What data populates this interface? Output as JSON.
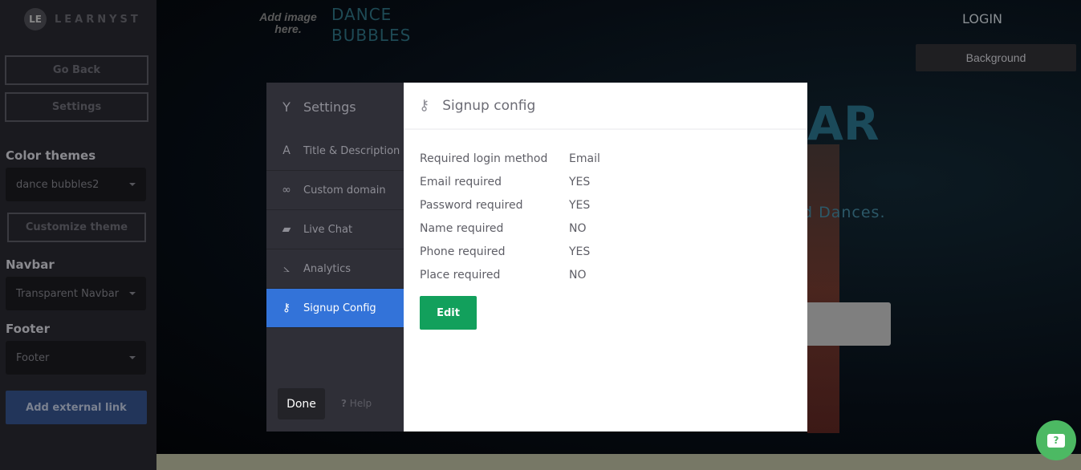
{
  "sidebar": {
    "logo_text": "LEARNYST",
    "logo_mark": "LE",
    "go_back": "Go Back",
    "settings": "Settings",
    "color_themes_label": "Color themes",
    "color_theme_value": "dance bubbles2",
    "customize_theme": "Customize theme",
    "navbar_label": "Navbar",
    "navbar_value": "Transparent Navbar",
    "footer_label": "Footer",
    "footer_value": "Footer",
    "add_external_link": "Add external link"
  },
  "site": {
    "add_image": "Add image here.",
    "brand_line1": "DANCE",
    "brand_line2": "BUBBLES",
    "login": "LOGIN",
    "background_button": "Background",
    "hero_title_partial": "AR",
    "hero_subtitle_partial": "d Dances."
  },
  "modal": {
    "nav_title": "Settings",
    "nav_items": [
      {
        "label": "Title & Description",
        "icon": "font-icon"
      },
      {
        "label": "Custom domain",
        "icon": "link-icon"
      },
      {
        "label": "Live Chat",
        "icon": "chat-icon"
      },
      {
        "label": "Analytics",
        "icon": "chart-icon"
      },
      {
        "label": "Signup Config",
        "icon": "key-icon",
        "active": true
      }
    ],
    "done": "Done",
    "help": "Help",
    "help_glyph": "?",
    "content_title": "Signup config",
    "rows": [
      {
        "label": "Required login method",
        "value": "Email"
      },
      {
        "label": "Email required",
        "value": "YES"
      },
      {
        "label": "Password required",
        "value": "YES"
      },
      {
        "label": "Name required",
        "value": "NO"
      },
      {
        "label": "Phone required",
        "value": "YES"
      },
      {
        "label": "Place required",
        "value": "NO"
      }
    ],
    "edit": "Edit"
  },
  "chat_widget": {
    "glyph": "?"
  },
  "colors": {
    "accent": "#3373d9",
    "edit_green": "#12a05c",
    "chat_green": "#4cb963"
  }
}
